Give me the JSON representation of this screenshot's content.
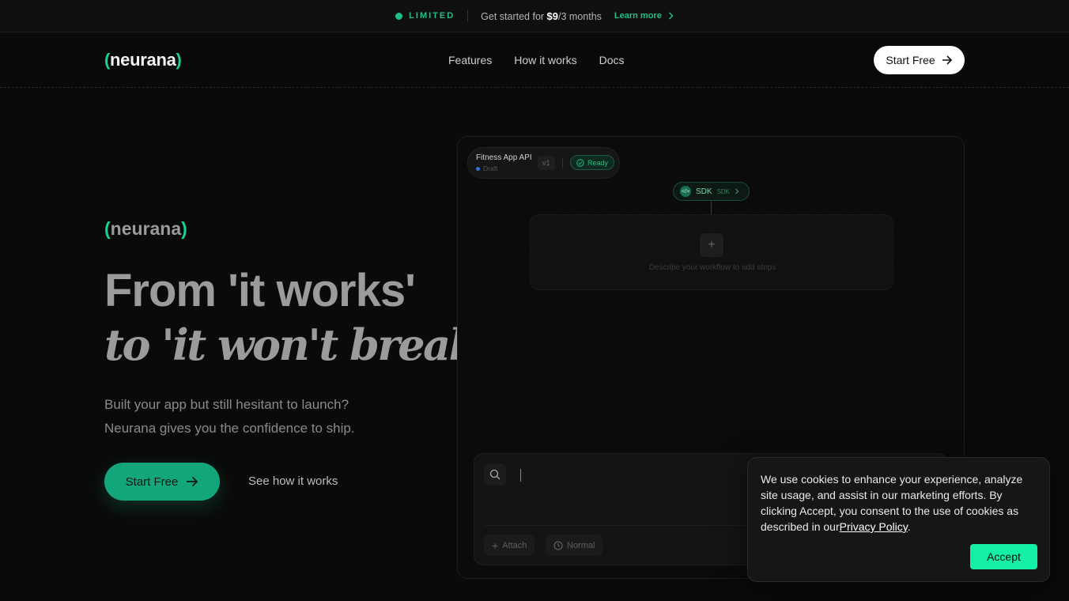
{
  "announcement": {
    "badge": "LIMITED",
    "offer_prefix": "Get started for ",
    "offer_price": "$9",
    "offer_suffix": "/3 months",
    "link": "Learn more"
  },
  "brand": {
    "open": "(",
    "name": "neurana",
    "close": ")"
  },
  "nav": {
    "links": [
      "Features",
      "How it works",
      "Docs"
    ],
    "cta": "Start Free"
  },
  "hero": {
    "headline_line1": "From 'it works'",
    "headline_line2": "to 'it won't break'.",
    "sub_line1": "Built your app but still hesitant to launch?",
    "sub_line2": "Neurana gives you the confidence to ship.",
    "cta_primary": "Start Free",
    "cta_secondary": "See how it works"
  },
  "preview": {
    "project_name": "Fitness App API",
    "project_status": "Draft",
    "version": "v1",
    "ready": "Ready",
    "sdk_label": "SDK",
    "sdk_small": "SDK",
    "workflow_hint": "Describe your workflow to add steps",
    "chip_attach": "Attach",
    "chip_mode": "Normal"
  },
  "cookie": {
    "text": "We use cookies to enhance your experience, analyze site usage, and assist in our marketing efforts. By clicking Accept, you consent to the use of cookies as described in our",
    "link": "Privacy Policy",
    "period": ".",
    "accept": "Accept"
  },
  "colors": {
    "accent": "#1fd18f",
    "cta_green": "#13a67a",
    "accept_green": "#14f0a6",
    "background": "#0a0a0a"
  }
}
